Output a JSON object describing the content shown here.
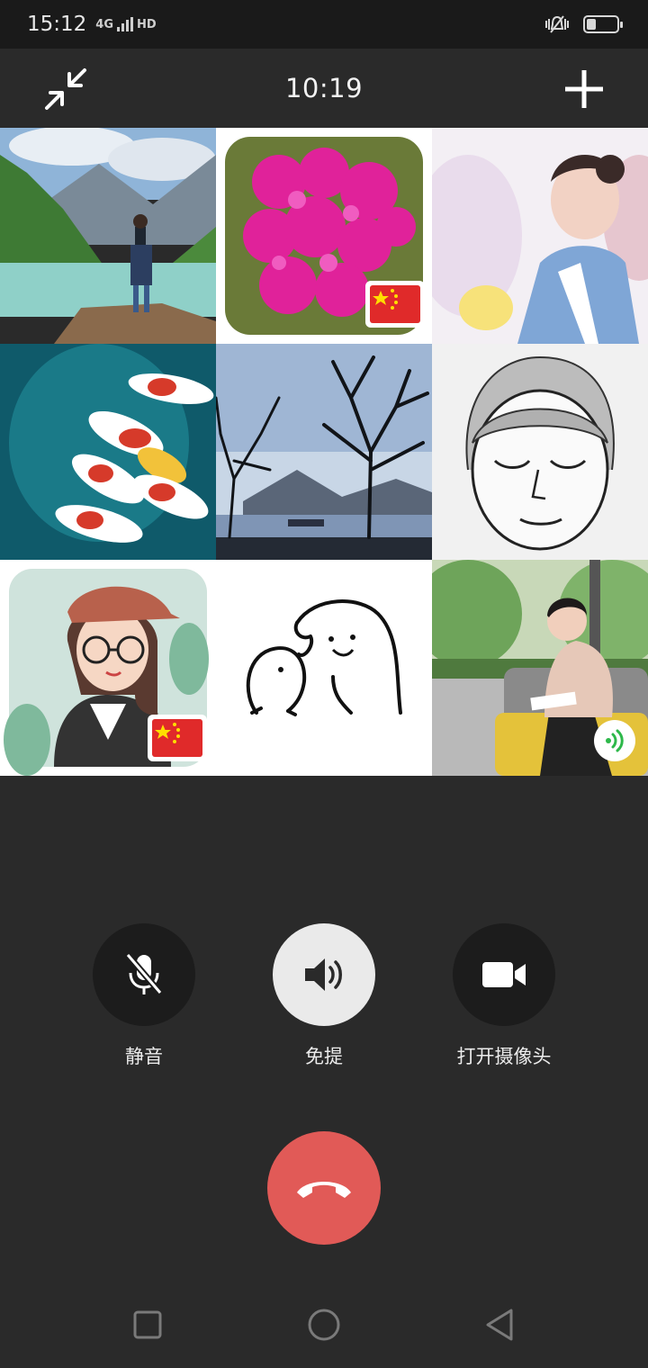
{
  "status_bar": {
    "time": "15:12",
    "network": "4G",
    "hd": "HD",
    "battery_level": 0.3
  },
  "call": {
    "timer": "10:19"
  },
  "icons": {
    "shrink": "shrink-window-icon",
    "add": "add-participant-icon",
    "mute": "mic-muted-icon",
    "speaker": "speaker-icon",
    "camera": "video-camera-icon",
    "hangup": "hang-up-icon",
    "speaking": "voice-activity-icon"
  },
  "participants": [
    {
      "avatar": "mountain-lake-photo"
    },
    {
      "avatar": "pink-flowers-photo",
      "badge": "china-flag"
    },
    {
      "avatar": "girl-portrait-photo"
    },
    {
      "avatar": "koi-fish-painting"
    },
    {
      "avatar": "bare-trees-lake-photo"
    },
    {
      "avatar": "sketch-face-drawing"
    },
    {
      "avatar": "cartoon-girl-glasses",
      "badge": "china-flag"
    },
    {
      "avatar": "two-doodle-characters"
    },
    {
      "avatar": "woman-reading-photo",
      "speaking": true
    }
  ],
  "controls": {
    "mute_label": "静音",
    "speaker_label": "免提",
    "camera_label": "打开摄像头"
  },
  "colors": {
    "background": "#2a2a2a",
    "status_bar": "#1a1a1a",
    "hangup": "#e15a57",
    "speaker_active": "#eaeaea",
    "speaking_indicator": "#2db84a"
  },
  "nav": {
    "recent": "square-icon",
    "home": "circle-icon",
    "back": "triangle-back-icon"
  }
}
